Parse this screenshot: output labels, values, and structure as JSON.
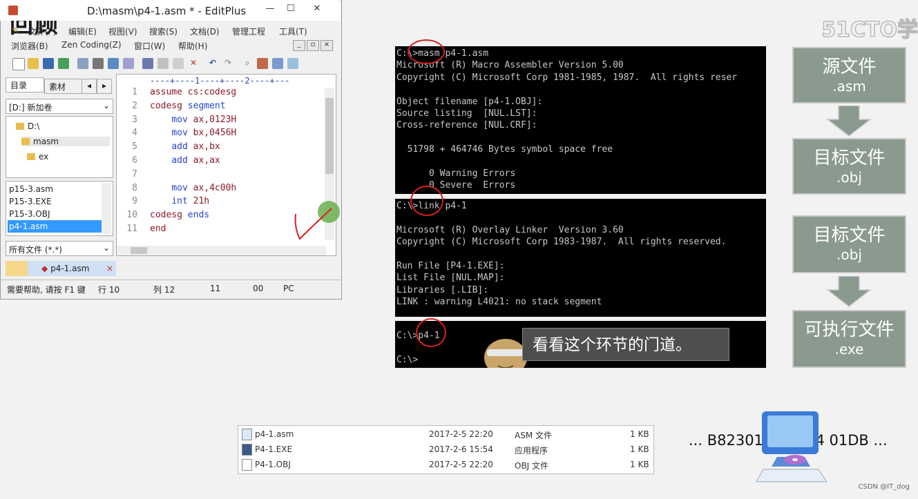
{
  "title": "回顾",
  "logo": "51CTO学",
  "editor_window": {
    "title": "D:\\masm\\p4-1.asm * - EditPlus",
    "menu_row1": [
      "文件(F)",
      "编辑(E)",
      "视图(V)",
      "搜索(S)",
      "文档(D)",
      "管理工程",
      "工具(T)"
    ],
    "menu_row2": [
      "浏览器(B)",
      "Zen Coding(Z)",
      "窗口(W)",
      "帮助(H)"
    ],
    "tabs": [
      "目录",
      "素材"
    ],
    "drive": "[D:] 新加卷",
    "folders": [
      "D:\\",
      "masm",
      "ex"
    ],
    "files": [
      "p15-3.asm",
      "P15-3.EXE",
      "P15-3.OBJ",
      "p4-1.asm"
    ],
    "filter": "所有文件 (*.*)",
    "open_tab": "p4-1.asm",
    "ruler": "----+----1----+----2----+---",
    "code_lines": [
      {
        "n": "1",
        "code": "assume cs:codesg"
      },
      {
        "n": "2",
        "code": "codesg segment"
      },
      {
        "n": "3",
        "code": "    mov ax,0123H"
      },
      {
        "n": "4",
        "code": "    mov bx,0456H"
      },
      {
        "n": "5",
        "code": "    add ax,bx"
      },
      {
        "n": "6",
        "code": "    add ax,ax"
      },
      {
        "n": "7",
        "code": ""
      },
      {
        "n": "8",
        "code": "    mov ax,4c00h"
      },
      {
        "n": "9",
        "code": "    int 21h"
      },
      {
        "n": "10",
        "code": "codesg ends"
      },
      {
        "n": "11",
        "code": "end"
      }
    ],
    "status": [
      "需要帮助, 请按 F1 键",
      "行 10",
      "列 12",
      "11",
      "00",
      "PC"
    ]
  },
  "terminal1": [
    "C:\\>masm p4-1.asm",
    "Microsoft (R) Macro Assembler Version 5.00",
    "Copyright (C) Microsoft Corp 1981-1985, 1987.  All rights reser",
    "",
    "Object filename [p4-1.OBJ]:",
    "Source listing  [NUL.LST]:",
    "Cross-reference [NUL.CRF]:",
    "",
    "  51798 + 464746 Bytes symbol space free",
    "",
    "      0 Warning Errors",
    "      0 Severe  Errors"
  ],
  "terminal2": [
    "C:\\>link p4-1",
    "",
    "Microsoft (R) Overlay Linker  Version 3.60",
    "Copyright (C) Microsoft Corp 1983-1987.  All rights reserved.",
    "",
    "Run File [P4-1.EXE]:",
    "List File [NUL.MAP]:",
    "Libraries [.LIB]:",
    "LINK : warning L4021: no stack segment"
  ],
  "terminal3": [
    "C:\\>p4-1",
    "C:\\>"
  ],
  "speech": "看看这个环节的门道。",
  "flow": [
    {
      "name": "源文件",
      "ext": ".asm"
    },
    {
      "name": "目标文件",
      "ext": ".obj"
    },
    {
      "name": "目标文件",
      "ext": ".obj"
    },
    {
      "name": "可执行文件",
      "ext": ".exe"
    }
  ],
  "file_list": [
    {
      "name": "p4-1.asm",
      "date": "2017-2-5 22:20",
      "type": "ASM 文件",
      "size": "1 KB"
    },
    {
      "name": "P4-1.EXE",
      "date": "2017-2-6 15:54",
      "type": "应用程序",
      "size": "1 KB"
    },
    {
      "name": "P4-1.OBJ",
      "date": "2017-2-5 22:20",
      "type": "OBJ 文件",
      "size": "1 KB"
    }
  ],
  "hex": "... B82301 BB5604 01DB ...",
  "watermark": "CSDN @IT_dog",
  "colors": {
    "flow_box": "#8a9a8e",
    "annotation_red": "#d8201c",
    "terminal_bg": "#000000"
  }
}
